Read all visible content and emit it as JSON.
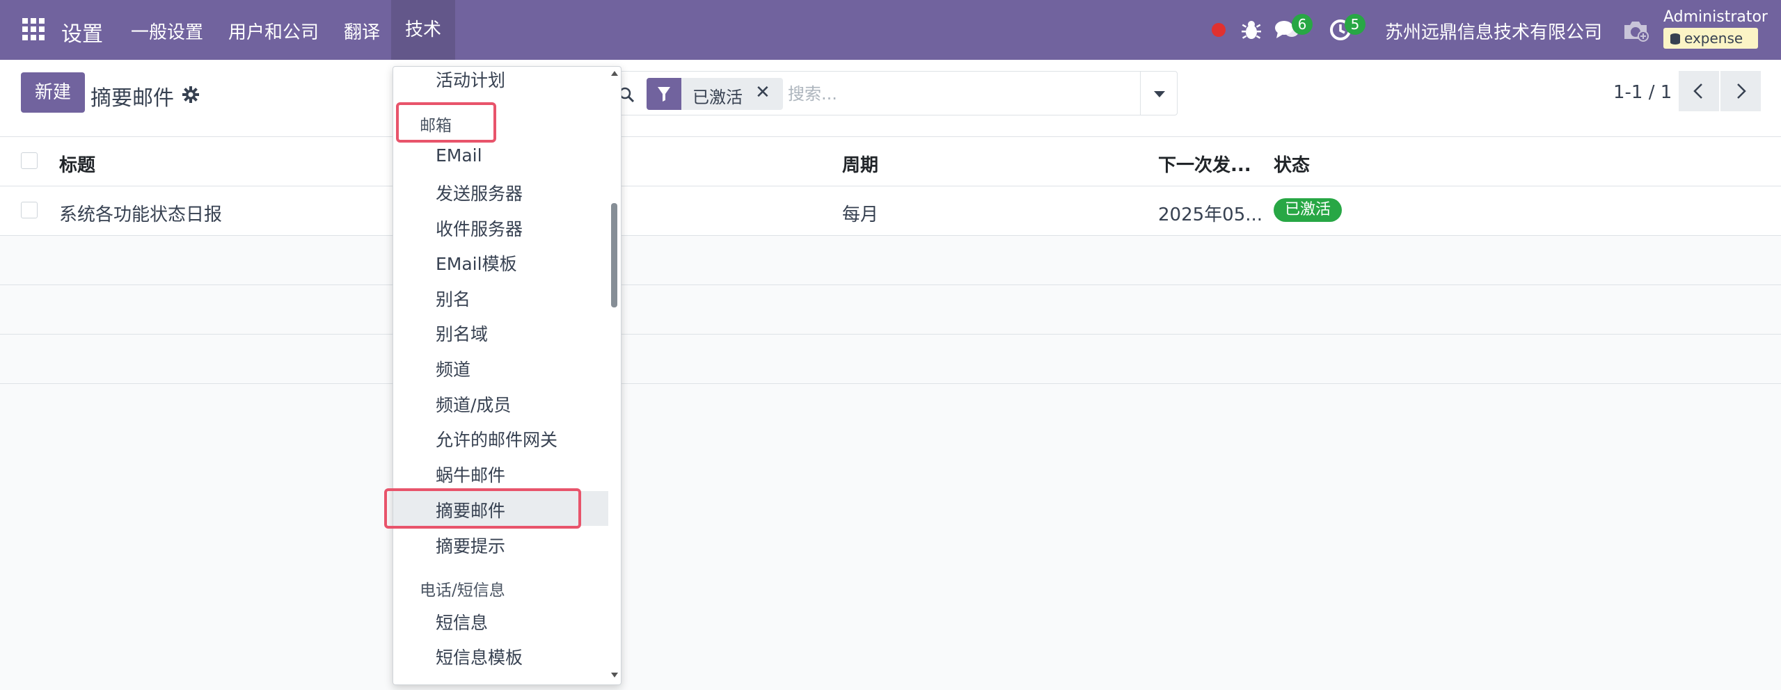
{
  "nav": {
    "app_title": "设置",
    "menu": [
      "一般设置",
      "用户和公司",
      "翻译",
      "技术"
    ],
    "messages_count": "6",
    "activities_count": "5",
    "company": "苏州远鼎信息技术有限公司",
    "user": "Administrator",
    "database": "expense"
  },
  "control": {
    "new_label": "新建",
    "title": "摘要邮件",
    "facet_label": "已激活",
    "facet_close": "✕",
    "search_placeholder": "搜索...",
    "pager": "1-1 / 1"
  },
  "list": {
    "columns": {
      "title": "标题",
      "period": "周期",
      "next_send": "下一次发...",
      "status": "状态"
    },
    "rows": [
      {
        "title": "系统各功能状态日报",
        "period": "每月",
        "next_send": "2025年05...",
        "status": "已激活"
      }
    ]
  },
  "dropdown": {
    "items": {
      "activity_plan": "活动计划",
      "mailbox_header": "邮箱",
      "email": "EMail",
      "outgoing_servers": "发送服务器",
      "incoming_servers": "收件服务器",
      "email_templates": "EMail模板",
      "aliases": "别名",
      "alias_domains": "别名域",
      "channels": "频道",
      "channel_members": "频道/成员",
      "allowed_gateways": "允许的邮件网关",
      "snail_mail": "蜗牛邮件",
      "digest_emails": "摘要邮件",
      "digest_tips": "摘要提示",
      "phone_sms_header": "电话/短信息",
      "sms": "短信息",
      "sms_templates": "短信息模板"
    }
  },
  "colors": {
    "brand": "#71639e",
    "success": "#28a745",
    "highlight": "#e8546b",
    "record_dot": "#e0312f"
  }
}
